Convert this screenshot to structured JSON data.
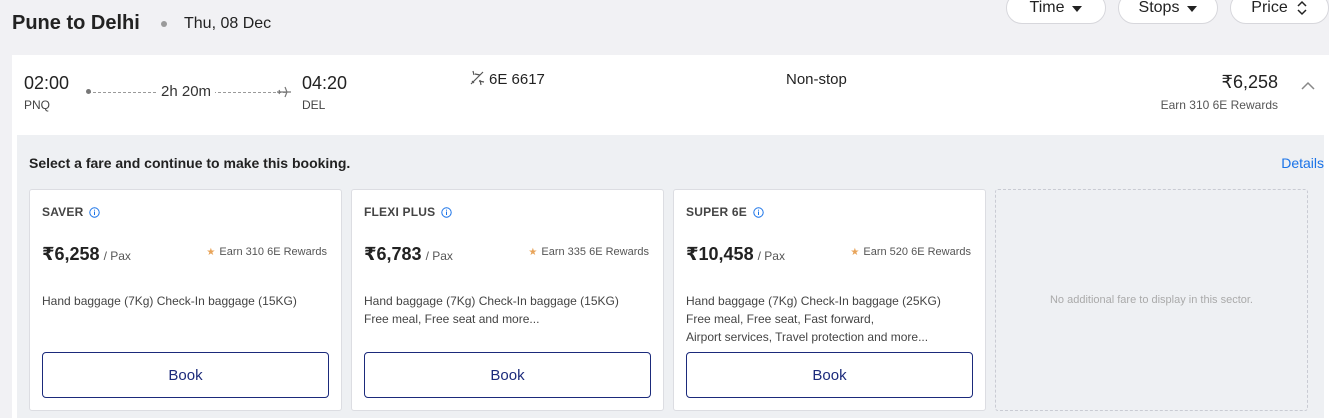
{
  "header": {
    "route": "Pune to Delhi",
    "date": "Thu, 08 Dec"
  },
  "sort": {
    "time_label": "Time",
    "stops_label": "Stops",
    "price_label": "Price"
  },
  "flight": {
    "dep_time": "02:00",
    "dep_code": "PNQ",
    "duration": "2h 20m",
    "arr_time": "04:20",
    "arr_code": "DEL",
    "flight_no": "6E 6617",
    "stops": "Non-stop",
    "price": "₹6,258",
    "rewards": "Earn 310 6E Rewards"
  },
  "fare_panel": {
    "prompt": "Select a fare and continue to make this booking.",
    "details_label": "Details",
    "empty_message": "No additional fare to display in this sector.",
    "fares": [
      {
        "name": "SAVER",
        "price": "₹6,258",
        "pax": "/ Pax",
        "rewards": "Earn 310 6E Rewards",
        "desc": [
          "Hand baggage (7Kg) Check-In baggage (15KG)"
        ],
        "book_label": "Book"
      },
      {
        "name": "FLEXI PLUS",
        "price": "₹6,783",
        "pax": "/ Pax",
        "rewards": "Earn 335 6E Rewards",
        "desc": [
          "Hand baggage (7Kg) Check-In baggage (15KG)",
          "Free meal, Free seat and more..."
        ],
        "book_label": "Book"
      },
      {
        "name": "SUPER 6E",
        "price": "₹10,458",
        "pax": "/ Pax",
        "rewards": "Earn 520 6E Rewards",
        "desc": [
          "Hand baggage (7Kg) Check-In baggage (25KG)",
          "Free meal, Free seat, Fast forward,",
          "Airport services, Travel protection and more..."
        ],
        "book_label": "Book"
      }
    ]
  },
  "icons": {
    "info": "info-icon",
    "plane": "plane-icon",
    "collapse": "chevron-up-icon",
    "star": "star-icon"
  },
  "colors": {
    "accent": "#1b2a7b",
    "link": "#1a73e8",
    "star": "#e8a45a"
  }
}
